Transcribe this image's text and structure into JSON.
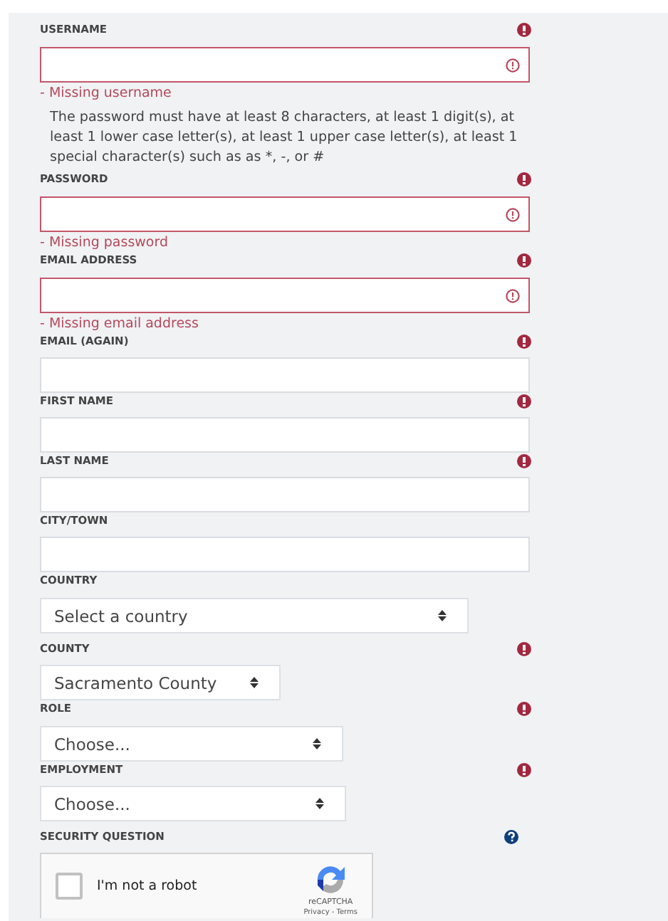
{
  "fields": [
    {
      "kind": "text",
      "label": "USERNAME",
      "required": true,
      "invalid": true,
      "error": "- Missing username"
    },
    {
      "kind": "help",
      "text": "The password must have at least 8 characters, at least 1 digit(s), at least 1 lower case letter(s), at least 1 upper case letter(s), at least 1 special character(s) such as as *, -, or #"
    },
    {
      "kind": "text",
      "label": "PASSWORD",
      "required": true,
      "invalid": true,
      "error": "- Missing password"
    },
    {
      "kind": "text",
      "label": "EMAIL ADDRESS",
      "required": true,
      "invalid": true,
      "error": "- Missing email address"
    },
    {
      "kind": "text",
      "label": "EMAIL (AGAIN)",
      "required": true,
      "invalid": false
    },
    {
      "kind": "text",
      "label": "FIRST NAME",
      "required": true,
      "invalid": false
    },
    {
      "kind": "text",
      "label": "LAST NAME",
      "required": true,
      "invalid": false
    },
    {
      "kind": "text",
      "label": "CITY/TOWN",
      "required": false,
      "invalid": false
    },
    {
      "kind": "select",
      "label": "COUNTRY",
      "required": false,
      "value": "Select a country"
    },
    {
      "kind": "select",
      "label": "COUNTY",
      "required": true,
      "value": "Sacramento County"
    },
    {
      "kind": "select",
      "label": "ROLE",
      "required": true,
      "value": "Choose..."
    },
    {
      "kind": "select",
      "label": "EMPLOYMENT",
      "required": true,
      "value": "Choose..."
    },
    {
      "kind": "captcha",
      "label": "SECURITY QUESTION",
      "checked": false,
      "text": "I'm not a robot",
      "brand": "reCAPTCHA",
      "links": "Privacy - Terms"
    }
  ]
}
